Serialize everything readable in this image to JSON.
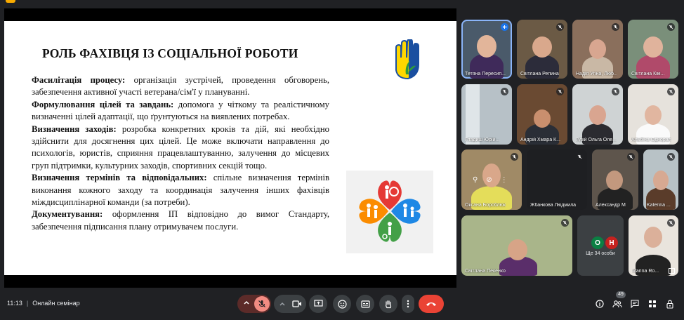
{
  "slide": {
    "title": "РОЛЬ ФАХІВЦЯ ІЗ СОЦІАЛЬНОЇ РОБОТИ",
    "paragraphs": [
      {
        "head": "Фасилітація процесу:",
        "text": " організація зустрічей, проведення обговорень, забезпечення активної участі ветерана/сім'ї у плануванні."
      },
      {
        "head": "Формулювання цілей та завдань:",
        "text": " допомога у чіткому та реалістичному визначенні цілей адаптації, що ґрунтуються на виявлених потребах."
      },
      {
        "head": "Визначення заходів:",
        "text": " розробка конкретних кроків та дій, які необхідно здійснити для досягнення цих цілей. Це може включати направлення до психологів, юристів, сприяння працевлаштуванню, залучення до місцевих груп підтримки, культурних заходів, спортивних секцій тощо."
      },
      {
        "head": "Визначення термінів та відповідальних:",
        "text": " спільне визначення термінів виконання кожного заходу та координація залучення інших фахівців міждисциплінарної команди (за потреби)."
      },
      {
        "head": "Документування:",
        "text": " оформлення ІП відповідно до вимог Стандарту, забезпечення підписання плану отримувачем послуги."
      }
    ]
  },
  "participants": [
    {
      "name": "Тетяна Пересип...",
      "speaking": true
    },
    {
      "name": "Світлана Репина"
    },
    {
      "name": "Надія Угіна, Люб..."
    },
    {
      "name": "Світлана Кім..."
    },
    {
      "name": "Гладиш Юрій..."
    },
    {
      "name": "Андрій Хмара К..."
    },
    {
      "name": "Гузій Ольга Оле..."
    },
    {
      "name": "Альбіна Однорал"
    },
    {
      "name": "Оксана Бороблюк"
    },
    {
      "name": "Жбанкова Людмила"
    },
    {
      "name": "Александр М"
    },
    {
      "name": "Katerina ..."
    },
    {
      "name": "Світлана Пекенко"
    },
    {
      "name": "Marina Ro..."
    }
  ],
  "others": {
    "avatar1": "О",
    "avatar2": "Н",
    "label": "Ще 34 особи"
  },
  "meeting": {
    "time": "11:13",
    "separator": "|",
    "title": "Онлайн семінар"
  },
  "people_count": "49",
  "colors": {
    "end_call": "#ea4335",
    "mic_off": "#f28b82",
    "avatar_green": "#0b8043",
    "avatar_red": "#c5221f"
  }
}
